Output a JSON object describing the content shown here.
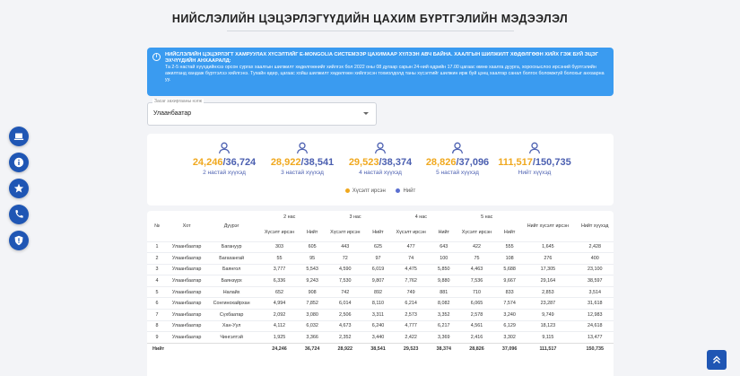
{
  "page": {
    "title": "НИЙСЛЭЛИЙН ЦЭЦЭРЛЭГҮҮДИЙН ЦАХИМ БҮРТГЭЛИЙН МЭДЭЭЛЭЛ"
  },
  "banner": {
    "icon": "info-icon",
    "heading": "НИЙСЛЭЛИЙН ЦЭЦЭРЛЭГТ ХАМРУУЛАХ ХҮСЭЛТИЙГ E-MONGOLIA СИСТЕМЭЭР ЦАХИМААР ХҮЛЭЭН АВЧ БАЙНА. ХААЛГЫН ШИЛЖИЛТ ХӨДӨЛГӨӨН ХИЙХ ГЭЖ БУЙ ЭЦЭГ ЭХЧҮҮДИЙН АНХААРАЛД:",
    "body": "Та 2-5 настай хүүхдийнхээ орсон сургах хаалгын шилжилт хөдөлгөөнийг хийлгэх бол 2022 оны 08 дугаар сарын 24-ний өдрийн 17.00 цагаас өмнө хаалга дуурга, хороохыслоо ирсэний бүртгэлийн ажилтанд хандаж бүртгэлээ хийлгэнэ. Тухайн өдөр, цагаас хойш шилжилт хөдөлгөөн хийлгэсэн тохиолдолд таны хүсэлтийг шилжин ирж буй цэнц хаалгар санал болгох боломжгүй болохыг анхаарна уу."
  },
  "sidebar": [
    {
      "name": "laptop-icon"
    },
    {
      "name": "info-icon"
    },
    {
      "name": "star-icon"
    },
    {
      "name": "phone-icon"
    },
    {
      "name": "shield-icon"
    }
  ],
  "select": {
    "label": "Засаг захиргааны нэгж",
    "value": "Улаанбаатар"
  },
  "stats": [
    {
      "done": "24,246",
      "sep": "/",
      "total": "36,724",
      "caption": "2 настай хүүхэд"
    },
    {
      "done": "28,922",
      "sep": "/",
      "total": "38,541",
      "caption": "3 настай хүүхэд"
    },
    {
      "done": "29,523",
      "sep": "/",
      "total": "38,374",
      "caption": "4 настай хүүхэд"
    },
    {
      "done": "28,826",
      "sep": "/",
      "total": "37,096",
      "caption": "5 настай хүүхэд"
    },
    {
      "done": "111,517",
      "sep": "/",
      "total": "150,735",
      "caption": "Нийт хүүхэд"
    }
  ],
  "legend": {
    "done_label": "Хүсэлт ирсэн",
    "total_label": "Нийт",
    "done_color": "#f0a81e",
    "total_color": "#5b6fd0"
  },
  "table": {
    "col_no": "№",
    "col_city": "Хот",
    "col_district": "Дүүрэг",
    "groups": [
      "2 нас",
      "3 нас",
      "4 нас",
      "5 нас"
    ],
    "sub_done": "Хүсэлт ирсэн",
    "sub_total": "Нийт",
    "col_total_done": "Нийт хүсэлт ирсэн",
    "col_total_all": "Нийт хүүхэд",
    "rows": [
      [
        "1",
        "Улаанбаатар",
        "Багануур",
        "303",
        "605",
        "443",
        "625",
        "477",
        "643",
        "422",
        "555",
        "1,645",
        "2,428"
      ],
      [
        "2",
        "Улаанбаатар",
        "Багахангай",
        "55",
        "95",
        "72",
        "97",
        "74",
        "100",
        "75",
        "108",
        "276",
        "400"
      ],
      [
        "3",
        "Улаанбаатар",
        "Баянгол",
        "3,777",
        "5,543",
        "4,590",
        "6,019",
        "4,475",
        "5,850",
        "4,463",
        "5,688",
        "17,305",
        "23,100"
      ],
      [
        "4",
        "Улаанбаатар",
        "Баянзүрх",
        "6,336",
        "9,243",
        "7,530",
        "9,807",
        "7,762",
        "9,880",
        "7,536",
        "9,667",
        "29,164",
        "38,597"
      ],
      [
        "5",
        "Улаанбаатар",
        "Налайх",
        "652",
        "908",
        "742",
        "892",
        "749",
        "881",
        "710",
        "833",
        "2,853",
        "3,514"
      ],
      [
        "6",
        "Улаанбаатар",
        "Сонгинохайрхан",
        "4,994",
        "7,852",
        "6,014",
        "8,110",
        "6,214",
        "8,082",
        "6,065",
        "7,574",
        "23,287",
        "31,618"
      ],
      [
        "7",
        "Улаанбаатар",
        "Сүхбаатар",
        "2,092",
        "3,080",
        "2,506",
        "3,311",
        "2,573",
        "3,352",
        "2,578",
        "3,240",
        "9,749",
        "12,983"
      ],
      [
        "8",
        "Улаанбаатар",
        "Хан-Уул",
        "4,112",
        "6,032",
        "4,673",
        "6,240",
        "4,777",
        "6,217",
        "4,561",
        "6,129",
        "18,123",
        "24,618"
      ],
      [
        "9",
        "Улаанбаатар",
        "Чингэлтэй",
        "1,925",
        "3,366",
        "2,352",
        "3,440",
        "2,422",
        "3,369",
        "2,416",
        "3,302",
        "9,115",
        "13,477"
      ]
    ],
    "footer_label": "Нийт",
    "footer": [
      "24,246",
      "36,724",
      "28,922",
      "38,541",
      "29,523",
      "38,374",
      "28,826",
      "37,096",
      "111,517",
      "150,735"
    ]
  },
  "scroll_top": {
    "icon": "double-chevron-up-icon"
  }
}
